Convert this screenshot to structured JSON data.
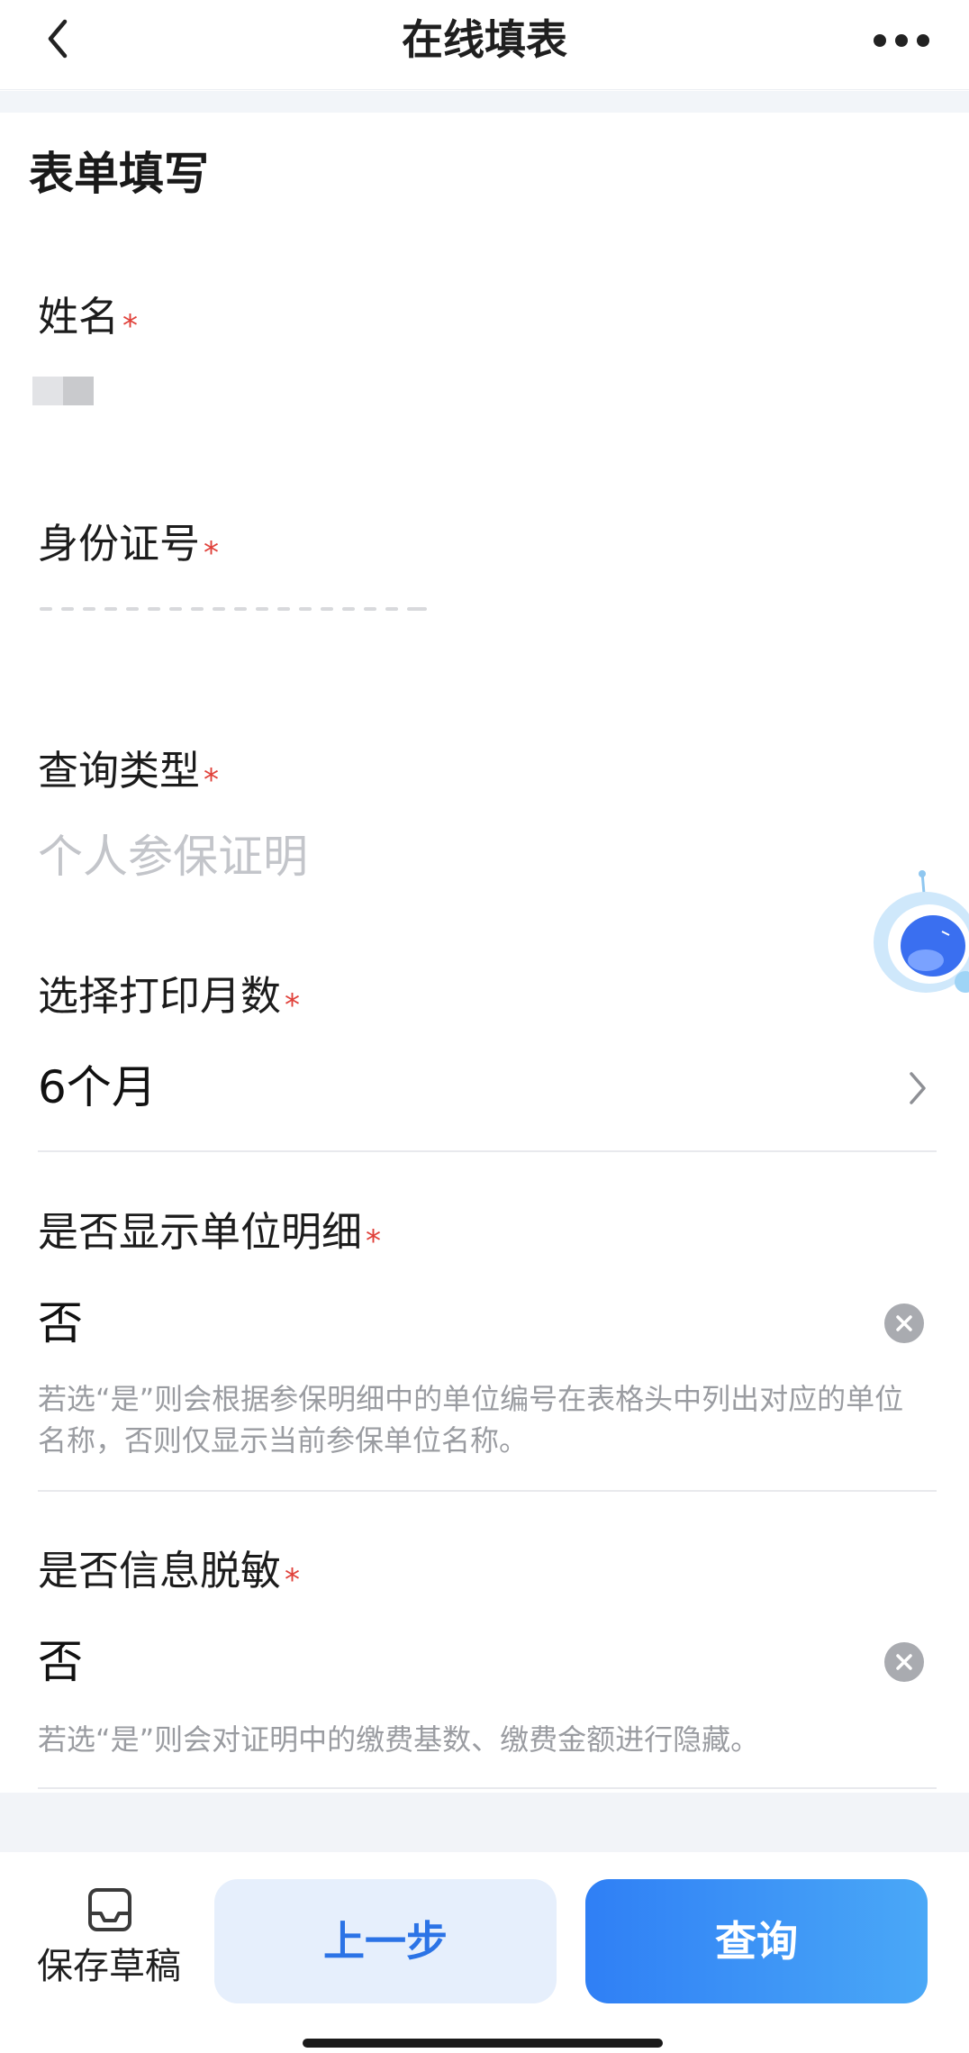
{
  "nav": {
    "title": "在线填表"
  },
  "section": {
    "title": "表单填写"
  },
  "required_mark": "*",
  "fields": {
    "name": {
      "label": "姓名"
    },
    "id_number": {
      "label": "身份证号"
    },
    "query_type": {
      "label": "查询类型",
      "value": "个人参保证明"
    },
    "print_months": {
      "label": "选择打印月数",
      "value": "6个月"
    },
    "show_unit_detail": {
      "label": "是否显示单位明细",
      "value": "否",
      "hint": "若选“是”则会根据参保明细中的单位编号在表格头中列出对应的单位名称，否则仅显示当前参保单位名称。"
    },
    "desensitize": {
      "label": "是否信息脱敏",
      "value": "否",
      "hint": "若选“是”则会对证明中的缴费基数、缴费金额进行隐藏。"
    }
  },
  "bottom": {
    "save_draft": "保存草稿",
    "prev_step": "上一步",
    "query": "查询"
  },
  "colors": {
    "required": "#e0413a",
    "primary": "#2f7ff5",
    "secondary_bg": "#e6effc"
  }
}
